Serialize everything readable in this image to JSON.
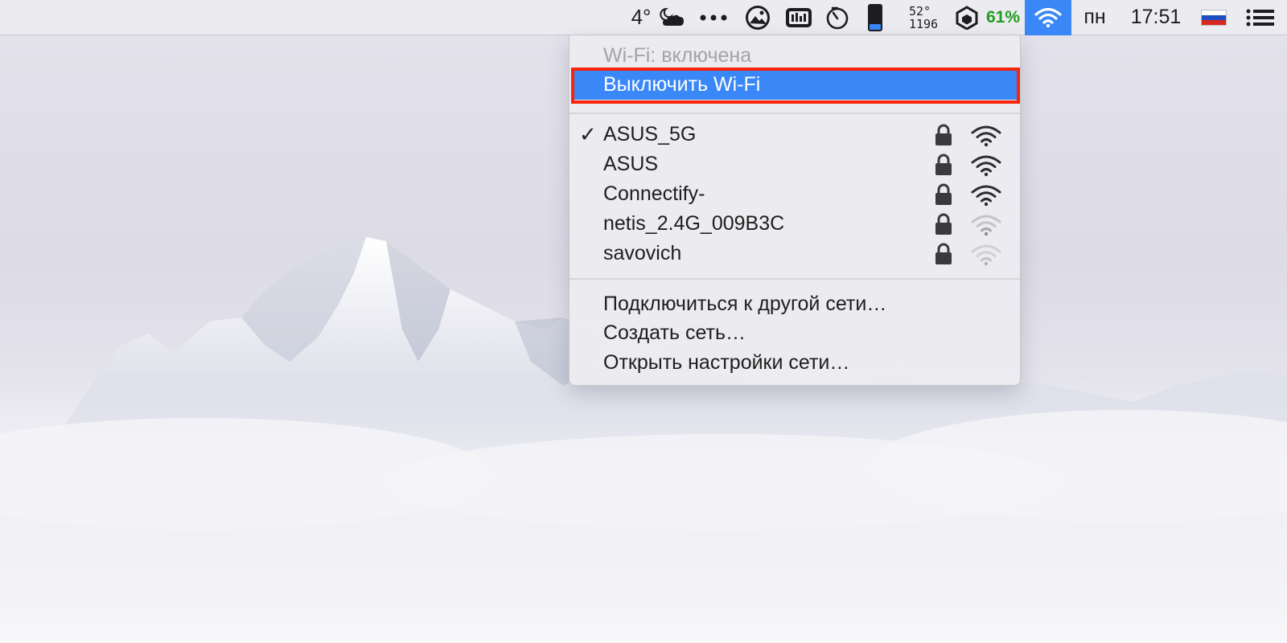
{
  "menubar": {
    "temperature": "4°",
    "weather_icon": "partly-cloudy-night-icon",
    "stats_line1": "52°",
    "stats_line2": "1196",
    "battery_percent": "61%",
    "battery_color": "#1e9e1e",
    "weekday": "пн",
    "time": "17:51",
    "input_flag_colors": [
      "#ffffff",
      "#1c4fc2",
      "#d8271e"
    ]
  },
  "wifi_menu": {
    "status": "Wi-Fi: включена",
    "toggle_label": "Выключить Wi-Fi",
    "highlight_color": "#3a87f7",
    "annotation_color": "#f4250b",
    "networks": [
      {
        "name": "ASUS_5G",
        "connected": true,
        "locked": true,
        "strength": "full"
      },
      {
        "name": "ASUS",
        "connected": false,
        "locked": true,
        "strength": "full"
      },
      {
        "name": "Connectify-",
        "connected": false,
        "locked": true,
        "strength": "full"
      },
      {
        "name": "netis_2.4G_009B3C",
        "connected": false,
        "locked": true,
        "strength": "weak"
      },
      {
        "name": "savovich",
        "connected": false,
        "locked": true,
        "strength": "weak"
      }
    ],
    "checkmark": "✓",
    "actions": [
      {
        "label": "Подключиться к другой сети…"
      },
      {
        "label": "Создать сеть…"
      },
      {
        "label": "Открыть настройки сети…"
      }
    ]
  }
}
